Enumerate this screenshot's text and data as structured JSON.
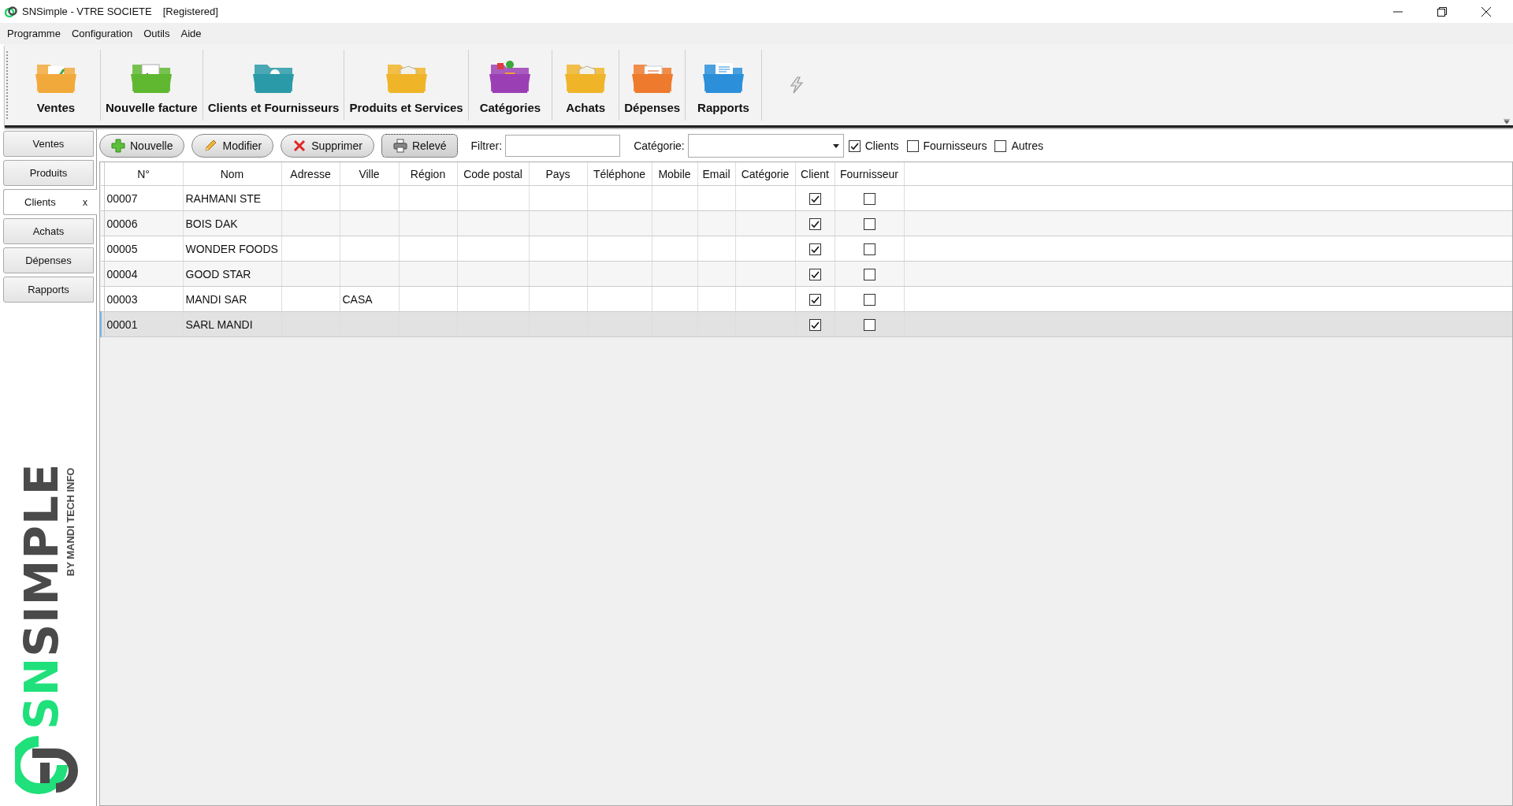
{
  "window": {
    "title": "SNSimple - VTRE SOCIETE",
    "badge": "[Registered]"
  },
  "menu": [
    "Programme",
    "Configuration",
    "Outils",
    "Aide"
  ],
  "toolbar": [
    {
      "label": "Ventes",
      "kind": "chart",
      "color": "#f2a93b"
    },
    {
      "label": "Nouvelle facture",
      "kind": "invoice",
      "color": "#5fb830"
    },
    {
      "label": "Clients et Fournisseurs",
      "kind": "person",
      "color": "#2a9aa8"
    },
    {
      "label": "Produits et Services",
      "kind": "box",
      "color": "#f0b429"
    },
    {
      "label": "Catégories",
      "kind": "tags",
      "color": "#9b3fb5"
    },
    {
      "label": "Achats",
      "kind": "box",
      "color": "#f0b429"
    },
    {
      "label": "Dépenses",
      "kind": "receipt",
      "color": "#ee7a2d"
    },
    {
      "label": "Rapports",
      "kind": "report",
      "color": "#2b8fd9"
    }
  ],
  "side_tabs": [
    {
      "label": "Ventes",
      "selected": false
    },
    {
      "label": "Produits",
      "selected": false
    },
    {
      "label": "Clients",
      "selected": true,
      "close": "x"
    },
    {
      "label": "Achats",
      "selected": false
    },
    {
      "label": "Dépenses",
      "selected": false
    },
    {
      "label": "Rapports",
      "selected": false
    }
  ],
  "actions": [
    {
      "label": "Nouvelle",
      "kind": "plus",
      "focused": false
    },
    {
      "label": "Modifier",
      "kind": "pencil",
      "focused": false
    },
    {
      "label": "Supprimer",
      "kind": "cross",
      "focused": false
    },
    {
      "label": "Relevé",
      "kind": "printer",
      "focused": true
    }
  ],
  "filter": {
    "label": "Filtrer:"
  },
  "category": {
    "label": "Catégorie:"
  },
  "filters": [
    {
      "label": "Clients",
      "checked": true
    },
    {
      "label": "Fournisseurs",
      "checked": false
    },
    {
      "label": "Autres",
      "checked": false
    }
  ],
  "table": {
    "columns": [
      "N°",
      "Nom",
      "Adresse",
      "Ville",
      "Région",
      "Code postal",
      "Pays",
      "Téléphone",
      "Mobile",
      "Email",
      "Catégorie",
      "Client",
      "Fournisseur"
    ],
    "rows": [
      {
        "cells": [
          "00007",
          "RAHMANI STE",
          "",
          "",
          "",
          "",
          "",
          "",
          "",
          "",
          ""
        ],
        "client": true,
        "fournisseur": false,
        "selected": false
      },
      {
        "cells": [
          "00006",
          "BOIS DAK",
          "",
          "",
          "",
          "",
          "",
          "",
          "",
          "",
          ""
        ],
        "client": true,
        "fournisseur": false,
        "selected": false
      },
      {
        "cells": [
          "00005",
          "WONDER FOODS",
          "",
          "",
          "",
          "",
          "",
          "",
          "",
          "",
          ""
        ],
        "client": true,
        "fournisseur": false,
        "selected": false
      },
      {
        "cells": [
          "00004",
          "GOOD STAR",
          "",
          "",
          "",
          "",
          "",
          "",
          "",
          "",
          ""
        ],
        "client": true,
        "fournisseur": false,
        "selected": false
      },
      {
        "cells": [
          "00003",
          "MANDI SAR",
          "",
          "CASA",
          "",
          "",
          "",
          "",
          "",
          "",
          ""
        ],
        "client": true,
        "fournisseur": false,
        "selected": false
      },
      {
        "cells": [
          "00001",
          "SARL MANDI",
          "",
          "",
          "",
          "",
          "",
          "",
          "",
          "",
          ""
        ],
        "client": true,
        "fournisseur": false,
        "selected": true
      }
    ]
  },
  "logo": {
    "accent": "SN",
    "rest": "SIMPLE",
    "tagline": "BY MANDI TECH INFO"
  }
}
